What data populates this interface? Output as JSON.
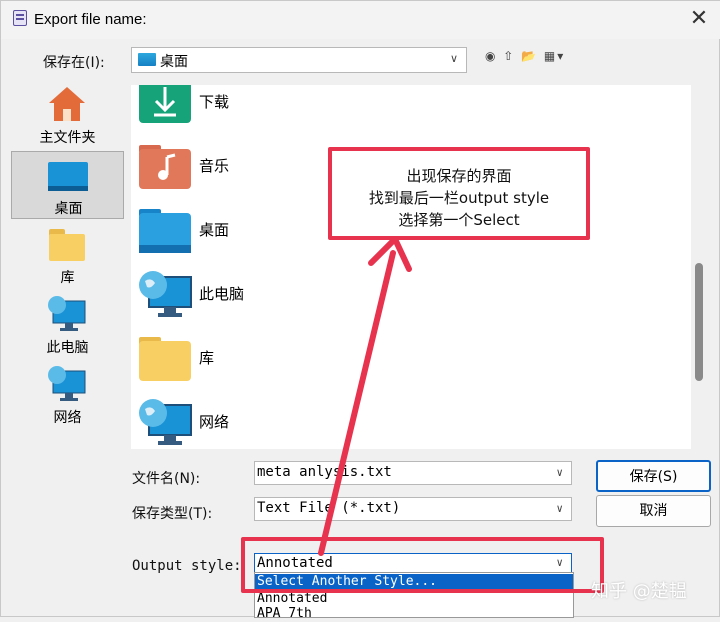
{
  "window": {
    "title": "Export file name:",
    "close": "✕"
  },
  "toolbar": {
    "save_in_label": "保存在(I):",
    "save_in_value": "桌面",
    "icons": "◉ ⇧ 📂 ▦▾"
  },
  "places": [
    {
      "label": "主文件夹",
      "icon": "home-icon"
    },
    {
      "label": "桌面",
      "icon": "desktop-icon",
      "selected": true
    },
    {
      "label": "库",
      "icon": "library-icon"
    },
    {
      "label": "此电脑",
      "icon": "computer-icon"
    },
    {
      "label": "网络",
      "icon": "network-icon"
    }
  ],
  "files": [
    {
      "name": "下载",
      "icon": "download-folder-icon"
    },
    {
      "name": "音乐",
      "icon": "music-folder-icon"
    },
    {
      "name": "桌面",
      "icon": "desktop-folder-icon"
    },
    {
      "name": "此电脑",
      "icon": "computer-icon"
    },
    {
      "name": "库",
      "icon": "library-folder-icon"
    },
    {
      "name": "网络",
      "icon": "network-icon"
    }
  ],
  "form": {
    "filename_label": "文件名(N):",
    "filename_value": "meta anlysis.txt",
    "filetype_label": "保存类型(T):",
    "filetype_value": "Text File (*.txt)",
    "output_label": "Output style:",
    "output_value": "Annotated"
  },
  "buttons": {
    "save": "保存(S)",
    "cancel": "取消"
  },
  "dropdown": {
    "options": [
      "Select Another Style...",
      "Annotated",
      "APA 7th"
    ],
    "selected_index": 0
  },
  "annotation": {
    "lines": [
      "出现保存的界面",
      "找到最后一栏output style",
      "选择第一个Select"
    ],
    "color": "#e8334f"
  },
  "watermark": "知乎 @楚韫"
}
